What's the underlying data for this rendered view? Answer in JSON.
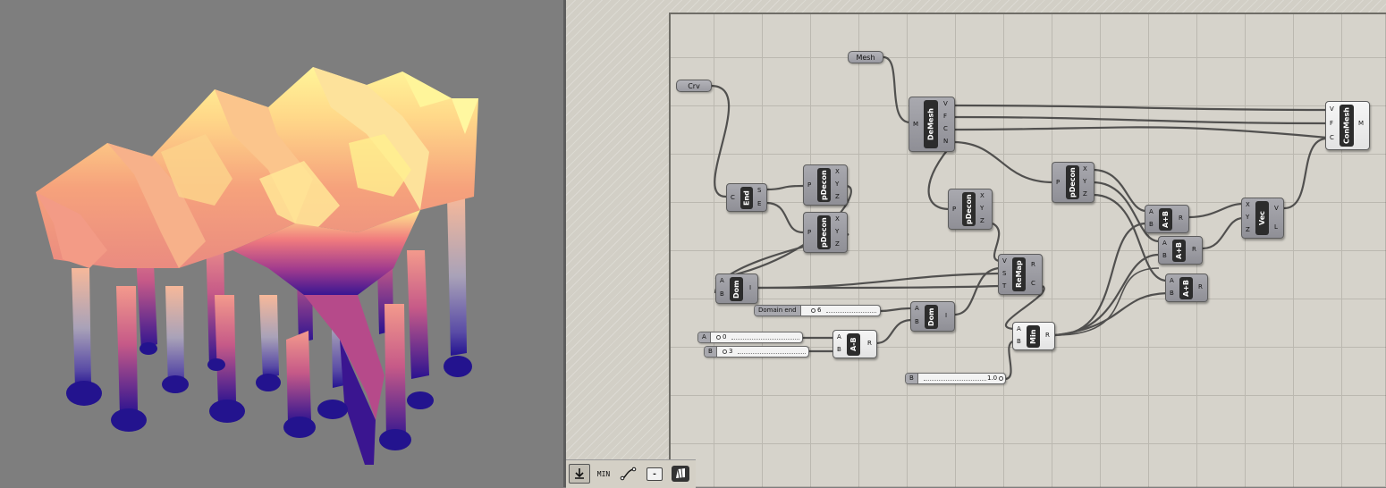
{
  "viewport": {
    "label": "3d-mesh-viewport"
  },
  "canvas": {
    "params": {
      "mesh": "Mesh",
      "crv": "Crv"
    },
    "components": {
      "demesh": {
        "name": "DeMesh",
        "inputs": [
          "M"
        ],
        "outputs": [
          "V",
          "F",
          "C",
          "N"
        ]
      },
      "conmesh": {
        "name": "ConMesh",
        "inputs": [
          "V",
          "F",
          "C"
        ],
        "outputs": [
          "M"
        ]
      },
      "end": {
        "name": "End",
        "inputs": [
          "C"
        ],
        "outputs": [
          "S",
          "E"
        ]
      },
      "pdecon1": {
        "name": "pDecon",
        "inputs": [
          "P"
        ],
        "outputs": [
          "X",
          "Y",
          "Z"
        ]
      },
      "pdecon2": {
        "name": "pDecon",
        "inputs": [
          "P"
        ],
        "outputs": [
          "X",
          "Y",
          "Z"
        ]
      },
      "pdecon3": {
        "name": "pDecon",
        "inputs": [
          "P"
        ],
        "outputs": [
          "X",
          "Y",
          "Z"
        ]
      },
      "pdecon4": {
        "name": "pDecon",
        "inputs": [
          "P"
        ],
        "outputs": [
          "X",
          "Y",
          "Z"
        ]
      },
      "dom1": {
        "name": "Dom",
        "inputs": [
          "A",
          "B"
        ],
        "outputs": [
          "I"
        ]
      },
      "dom2": {
        "name": "Dom",
        "inputs": [
          "A",
          "B"
        ],
        "outputs": [
          "I"
        ]
      },
      "remap": {
        "name": "ReMap",
        "inputs": [
          "V",
          "S",
          "T"
        ],
        "outputs": [
          "R",
          "C"
        ]
      },
      "apb1": {
        "name": "A+B",
        "inputs": [
          "A",
          "B"
        ],
        "outputs": [
          "R"
        ]
      },
      "apb2": {
        "name": "A+B",
        "inputs": [
          "A",
          "B"
        ],
        "outputs": [
          "R"
        ]
      },
      "apb3": {
        "name": "A+B",
        "inputs": [
          "A",
          "B"
        ],
        "outputs": [
          "R"
        ]
      },
      "vec": {
        "name": "Vec",
        "inputs": [
          "X",
          "Y",
          "Z"
        ],
        "outputs": [
          "V",
          "L"
        ]
      },
      "amb": {
        "name": "A-B",
        "inputs": [
          "A",
          "B"
        ],
        "outputs": [
          "R"
        ]
      },
      "min": {
        "name": "Min",
        "inputs": [
          "A",
          "B"
        ],
        "outputs": [
          "R"
        ]
      }
    },
    "sliders": {
      "domain_end": {
        "label": "Domain end",
        "value": "6"
      },
      "a": {
        "label": "A",
        "value": "0"
      },
      "b": {
        "label": "B",
        "value": "3"
      },
      "b2": {
        "label": "B",
        "value": "1.0"
      }
    }
  },
  "toolbar": {
    "min_label": "MIN",
    "minus_label": "-"
  }
}
